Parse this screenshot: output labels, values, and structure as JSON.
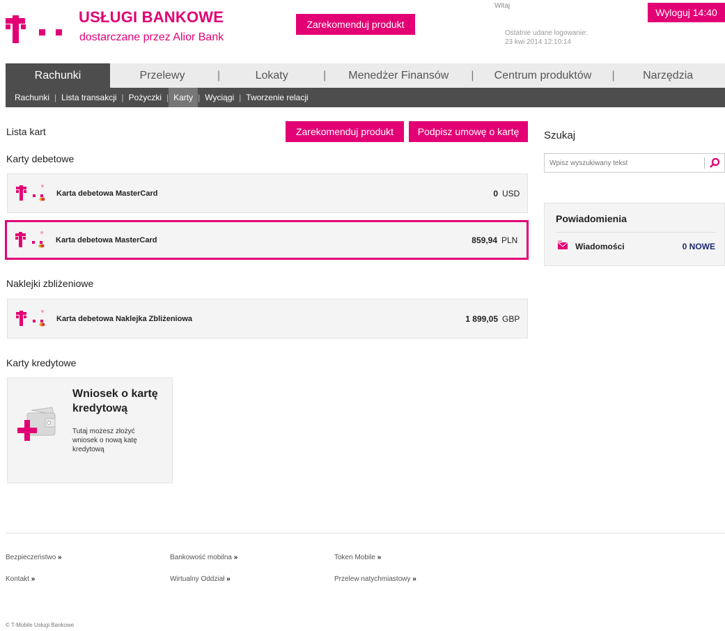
{
  "header": {
    "brand_title": "USŁUGI BANKOWE",
    "brand_subtitle": "dostarczane przez Alior Bank",
    "recommend_label": "Zarekomenduj produkt",
    "welcome": "Witaj",
    "last_login_label": "Ostatnie udane logowanie:",
    "last_login_value": "23 kwi 2014 12:10:14",
    "logout_label": "Wyloguj 14:40"
  },
  "mainnav": {
    "items": [
      "Rachunki",
      "Przelewy",
      "Lokaty",
      "Menedżer Finansów",
      "Centrum produktów",
      "Narzędzia"
    ]
  },
  "subnav": {
    "items": [
      "Rachunki",
      "Lista transakcji",
      "Pożyczki",
      "Karty",
      "Wyciągi",
      "Tworzenie relacji"
    ]
  },
  "content": {
    "page_title": "Lista kart",
    "recommend_label": "Zarekomenduj produkt",
    "sign_card_label": "Podpisz umowę o kartę",
    "debit_heading": "Karty debetowe",
    "sticker_heading": "Naklejki zbliżeniowe",
    "credit_heading": "Karty kredytowe",
    "cards": [
      {
        "name": "Karta debetowa MasterCard",
        "amount": "0",
        "currency": "USD"
      },
      {
        "name": "Karta debetowa MasterCard",
        "amount": "859,94",
        "currency": "PLN"
      },
      {
        "name": "Karta debetowa Naklejka Zbliżeniowa",
        "amount": "1 899,05",
        "currency": "GBP"
      }
    ],
    "credit_title": "Wniosek o kartę kredytową",
    "credit_desc": "Tutaj możesz złożyć wniosek o nową katę kredytową"
  },
  "sidebar": {
    "search_label": "Szukaj",
    "search_placeholder": "Wpisz wyszukiwany tekst",
    "notif_title": "Powiadomienia",
    "messages_label": "Wiadomości",
    "messages_count": "0 NOWE"
  },
  "footer": {
    "links": [
      "Bezpieczeństwo",
      "Bankowość mobilna",
      "Token Mobile",
      "Kontakt",
      "Wirtualny Oddział",
      "Przelew natychmiastowy"
    ],
    "copyright": "© T-Mobile Usługi Bankowe"
  },
  "colors": {
    "accent": "#e20074",
    "nav_dark": "#4d4d4d",
    "nav_light": "#ebebeb"
  }
}
